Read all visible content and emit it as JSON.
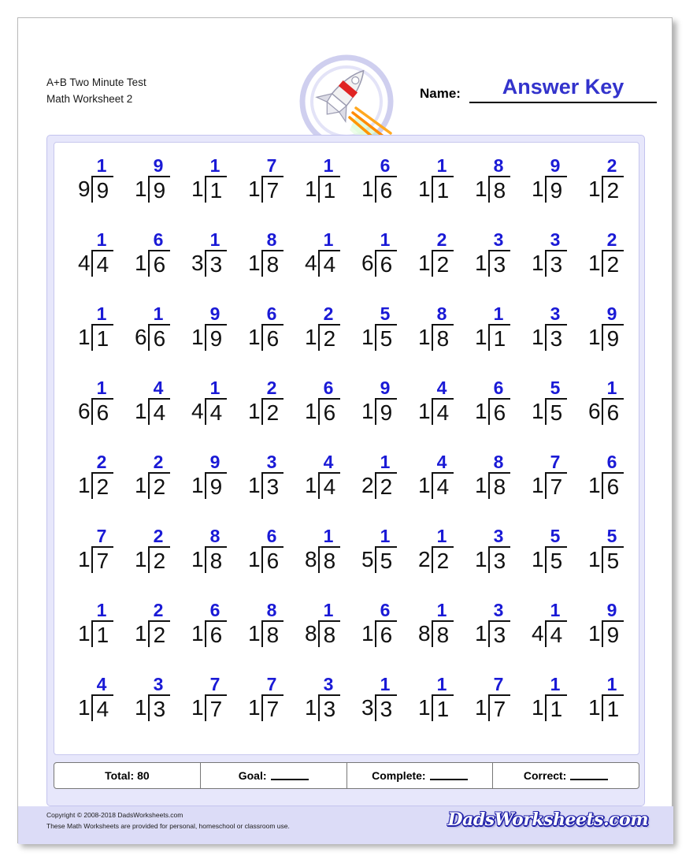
{
  "header": {
    "title_line1": "A+B Two Minute Test",
    "title_line2": "Math Worksheet 2",
    "name_label": "Name:",
    "answer_key_label": "Answer Key"
  },
  "logo": {
    "icon": "rocket-icon"
  },
  "problems": {
    "operator": "division",
    "rows": [
      [
        {
          "divisor": "9",
          "dividend": "9",
          "quotient": "1"
        },
        {
          "divisor": "1",
          "dividend": "9",
          "quotient": "9"
        },
        {
          "divisor": "1",
          "dividend": "1",
          "quotient": "1"
        },
        {
          "divisor": "1",
          "dividend": "7",
          "quotient": "7"
        },
        {
          "divisor": "1",
          "dividend": "1",
          "quotient": "1"
        },
        {
          "divisor": "1",
          "dividend": "6",
          "quotient": "6"
        },
        {
          "divisor": "1",
          "dividend": "1",
          "quotient": "1"
        },
        {
          "divisor": "1",
          "dividend": "8",
          "quotient": "8"
        },
        {
          "divisor": "1",
          "dividend": "9",
          "quotient": "9"
        },
        {
          "divisor": "1",
          "dividend": "2",
          "quotient": "2"
        }
      ],
      [
        {
          "divisor": "4",
          "dividend": "4",
          "quotient": "1"
        },
        {
          "divisor": "1",
          "dividend": "6",
          "quotient": "6"
        },
        {
          "divisor": "3",
          "dividend": "3",
          "quotient": "1"
        },
        {
          "divisor": "1",
          "dividend": "8",
          "quotient": "8"
        },
        {
          "divisor": "4",
          "dividend": "4",
          "quotient": "1"
        },
        {
          "divisor": "6",
          "dividend": "6",
          "quotient": "1"
        },
        {
          "divisor": "1",
          "dividend": "2",
          "quotient": "2"
        },
        {
          "divisor": "1",
          "dividend": "3",
          "quotient": "3"
        },
        {
          "divisor": "1",
          "dividend": "3",
          "quotient": "3"
        },
        {
          "divisor": "1",
          "dividend": "2",
          "quotient": "2"
        }
      ],
      [
        {
          "divisor": "1",
          "dividend": "1",
          "quotient": "1"
        },
        {
          "divisor": "6",
          "dividend": "6",
          "quotient": "1"
        },
        {
          "divisor": "1",
          "dividend": "9",
          "quotient": "9"
        },
        {
          "divisor": "1",
          "dividend": "6",
          "quotient": "6"
        },
        {
          "divisor": "1",
          "dividend": "2",
          "quotient": "2"
        },
        {
          "divisor": "1",
          "dividend": "5",
          "quotient": "5"
        },
        {
          "divisor": "1",
          "dividend": "8",
          "quotient": "8"
        },
        {
          "divisor": "1",
          "dividend": "1",
          "quotient": "1"
        },
        {
          "divisor": "1",
          "dividend": "3",
          "quotient": "3"
        },
        {
          "divisor": "1",
          "dividend": "9",
          "quotient": "9"
        }
      ],
      [
        {
          "divisor": "6",
          "dividend": "6",
          "quotient": "1"
        },
        {
          "divisor": "1",
          "dividend": "4",
          "quotient": "4"
        },
        {
          "divisor": "4",
          "dividend": "4",
          "quotient": "1"
        },
        {
          "divisor": "1",
          "dividend": "2",
          "quotient": "2"
        },
        {
          "divisor": "1",
          "dividend": "6",
          "quotient": "6"
        },
        {
          "divisor": "1",
          "dividend": "9",
          "quotient": "9"
        },
        {
          "divisor": "1",
          "dividend": "4",
          "quotient": "4"
        },
        {
          "divisor": "1",
          "dividend": "6",
          "quotient": "6"
        },
        {
          "divisor": "1",
          "dividend": "5",
          "quotient": "5"
        },
        {
          "divisor": "6",
          "dividend": "6",
          "quotient": "1"
        }
      ],
      [
        {
          "divisor": "1",
          "dividend": "2",
          "quotient": "2"
        },
        {
          "divisor": "1",
          "dividend": "2",
          "quotient": "2"
        },
        {
          "divisor": "1",
          "dividend": "9",
          "quotient": "9"
        },
        {
          "divisor": "1",
          "dividend": "3",
          "quotient": "3"
        },
        {
          "divisor": "1",
          "dividend": "4",
          "quotient": "4"
        },
        {
          "divisor": "2",
          "dividend": "2",
          "quotient": "1"
        },
        {
          "divisor": "1",
          "dividend": "4",
          "quotient": "4"
        },
        {
          "divisor": "1",
          "dividend": "8",
          "quotient": "8"
        },
        {
          "divisor": "1",
          "dividend": "7",
          "quotient": "7"
        },
        {
          "divisor": "1",
          "dividend": "6",
          "quotient": "6"
        }
      ],
      [
        {
          "divisor": "1",
          "dividend": "7",
          "quotient": "7"
        },
        {
          "divisor": "1",
          "dividend": "2",
          "quotient": "2"
        },
        {
          "divisor": "1",
          "dividend": "8",
          "quotient": "8"
        },
        {
          "divisor": "1",
          "dividend": "6",
          "quotient": "6"
        },
        {
          "divisor": "8",
          "dividend": "8",
          "quotient": "1"
        },
        {
          "divisor": "5",
          "dividend": "5",
          "quotient": "1"
        },
        {
          "divisor": "2",
          "dividend": "2",
          "quotient": "1"
        },
        {
          "divisor": "1",
          "dividend": "3",
          "quotient": "3"
        },
        {
          "divisor": "1",
          "dividend": "5",
          "quotient": "5"
        },
        {
          "divisor": "1",
          "dividend": "5",
          "quotient": "5"
        }
      ],
      [
        {
          "divisor": "1",
          "dividend": "1",
          "quotient": "1"
        },
        {
          "divisor": "1",
          "dividend": "2",
          "quotient": "2"
        },
        {
          "divisor": "1",
          "dividend": "6",
          "quotient": "6"
        },
        {
          "divisor": "1",
          "dividend": "8",
          "quotient": "8"
        },
        {
          "divisor": "8",
          "dividend": "8",
          "quotient": "1"
        },
        {
          "divisor": "1",
          "dividend": "6",
          "quotient": "6"
        },
        {
          "divisor": "8",
          "dividend": "8",
          "quotient": "1"
        },
        {
          "divisor": "1",
          "dividend": "3",
          "quotient": "3"
        },
        {
          "divisor": "4",
          "dividend": "4",
          "quotient": "1"
        },
        {
          "divisor": "1",
          "dividend": "9",
          "quotient": "9"
        }
      ],
      [
        {
          "divisor": "1",
          "dividend": "4",
          "quotient": "4"
        },
        {
          "divisor": "1",
          "dividend": "3",
          "quotient": "3"
        },
        {
          "divisor": "1",
          "dividend": "7",
          "quotient": "7"
        },
        {
          "divisor": "1",
          "dividend": "7",
          "quotient": "7"
        },
        {
          "divisor": "1",
          "dividend": "3",
          "quotient": "3"
        },
        {
          "divisor": "3",
          "dividend": "3",
          "quotient": "1"
        },
        {
          "divisor": "1",
          "dividend": "1",
          "quotient": "1"
        },
        {
          "divisor": "1",
          "dividend": "7",
          "quotient": "7"
        },
        {
          "divisor": "1",
          "dividend": "1",
          "quotient": "1"
        },
        {
          "divisor": "1",
          "dividend": "1",
          "quotient": "1"
        }
      ]
    ]
  },
  "totals": {
    "total_label": "Total: 80",
    "goal_label": "Goal:",
    "complete_label": "Complete:",
    "correct_label": "Correct:"
  },
  "footer": {
    "copyright": "Copyright © 2008-2018 DadsWorksheets.com",
    "usage": "These Math Worksheets are provided for personal, homeschool or classroom use.",
    "brand": "DadsWorksheets.com"
  },
  "colors": {
    "answer_blue": "#1a1ad6",
    "panel_bg": "#e7e7fb",
    "footer_bg": "#dcdcf7"
  }
}
